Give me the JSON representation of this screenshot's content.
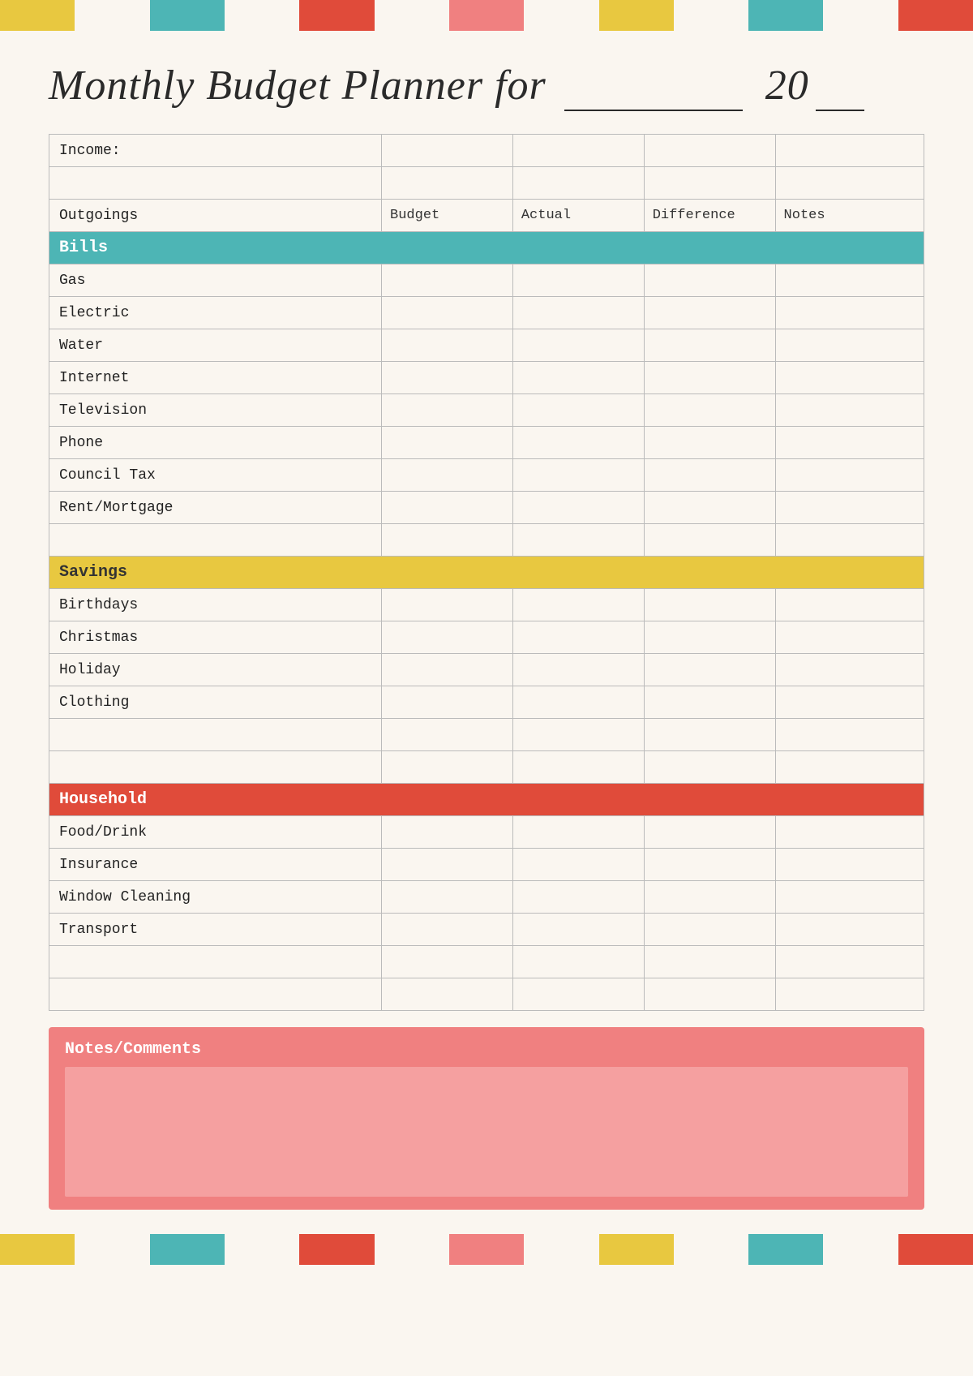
{
  "title": {
    "main": "Monthly Budget Planner for",
    "year_prefix": "20",
    "year_suffix": "__"
  },
  "deco_segments": [
    {
      "color": "#e8c840",
      "size": 1
    },
    {
      "color": "transparent",
      "size": 0.1
    },
    {
      "color": "#4db5b5",
      "size": 1
    },
    {
      "color": "transparent",
      "size": 0.1
    },
    {
      "color": "#e04b3a",
      "size": 1
    },
    {
      "color": "transparent",
      "size": 0.1
    },
    {
      "color": "#f08080",
      "size": 1
    },
    {
      "color": "transparent",
      "size": 0.1
    },
    {
      "color": "#e8c840",
      "size": 1
    },
    {
      "color": "transparent",
      "size": 0.1
    },
    {
      "color": "#4db5b5",
      "size": 1
    },
    {
      "color": "transparent",
      "size": 0.1
    },
    {
      "color": "#e04b3a",
      "size": 0.3
    }
  ],
  "table": {
    "income_label": "Income:",
    "headers": {
      "outgoings": "Outgoings",
      "budget": "Budget",
      "actual": "Actual",
      "difference": "Difference",
      "notes": "Notes"
    },
    "sections": {
      "bills": {
        "label": "Bills",
        "items": [
          "Gas",
          "Electric",
          "Water",
          "Internet",
          "Television",
          "Phone",
          "Council Tax",
          "Rent/Mortgage"
        ]
      },
      "savings": {
        "label": "Savings",
        "items": [
          "Birthdays",
          "Christmas",
          "Holiday",
          "Clothing"
        ]
      },
      "household": {
        "label": "Household",
        "items": [
          "Food/Drink",
          "Insurance",
          "Window Cleaning",
          "Transport"
        ]
      }
    }
  },
  "notes_section": {
    "label": "Notes/Comments"
  }
}
